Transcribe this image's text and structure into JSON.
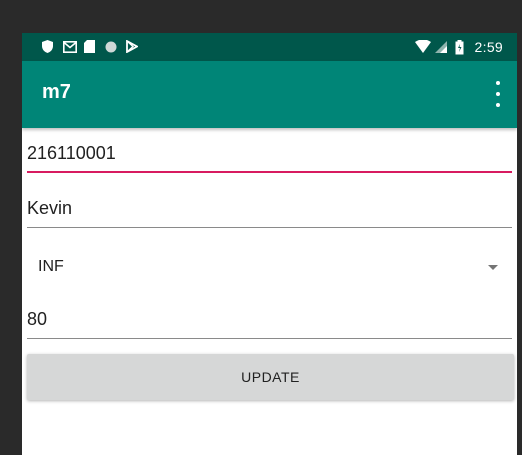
{
  "status_bar": {
    "icons_left": [
      "shield-icon",
      "mail-icon",
      "sd-card-icon",
      "circle-icon",
      "play-store-icon"
    ],
    "icons_right": [
      "wifi-icon",
      "signal-icon",
      "battery-icon"
    ],
    "time": "2:59"
  },
  "app_bar": {
    "title": "m7",
    "menu_icon": "more-vert-icon"
  },
  "form": {
    "id_value": "216110001",
    "name_value": "Kevin",
    "department_selected": "INF",
    "score_value": "80",
    "update_label": "UPDATE"
  },
  "colors": {
    "status_bar": "#00574B",
    "app_bar": "#008577",
    "accent": "#D81B60",
    "button": "#d6d7d7"
  }
}
